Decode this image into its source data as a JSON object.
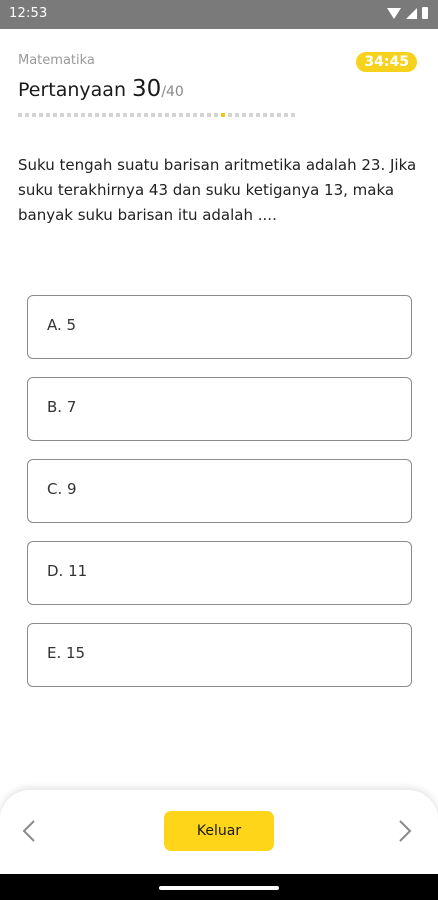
{
  "status_bar": {
    "time": "12:53",
    "icons": [
      "wifi-icon",
      "signal-icon",
      "battery-icon"
    ]
  },
  "header": {
    "subject": "Matematika",
    "timer": "34:45",
    "title_prefix": "Pertanyaan ",
    "question_number": "30",
    "question_total": "/40"
  },
  "progress": {
    "total": 40,
    "current": 30,
    "active_color": "#f2c318",
    "inactive_color": "#d4d4d4"
  },
  "question": {
    "text": "Suku tengah suatu barisan aritmetika adalah 23. Jika suku terakhirnya 43 dan suku ketiganya 13, maka banyak suku barisan itu adalah ...."
  },
  "options": [
    "A. 5",
    "B. 7",
    "C. 9",
    "D. 11",
    "E. 15"
  ],
  "footer": {
    "prev_icon": "chevron-left-icon",
    "next_icon": "chevron-right-icon",
    "exit_label": "Keluar",
    "exit_color": "#ffd51a"
  }
}
